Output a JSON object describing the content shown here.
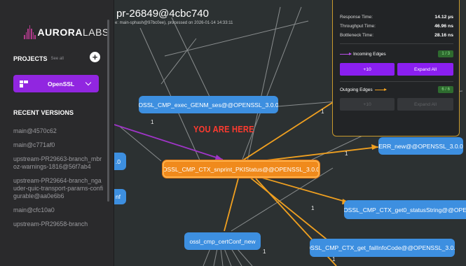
{
  "header": {
    "title": "pr-26849@4cbc740",
    "subtitle": "e: main-sphash@97bc0ee), processed on 2026-01-14 14:33:11"
  },
  "sidebar": {
    "logo_text_bold": "AURORA",
    "logo_text_light": "LABS",
    "projects_label": "PROJECTS",
    "see_all": "See all",
    "add_icon": "+",
    "selected_project": "OpenSSL",
    "recent_title": "RECENT VERSIONS",
    "versions": [
      "main@4570c62",
      "main@c771af0",
      "upstream-PR29663-branch_mbroz-warnings-1816@56f7ab4",
      "upstream-PR29664-branch_ngauder-quic-transport-params-configurable@aa0e6b6",
      "main@cfc10a0",
      "upstream-PR29658-branch"
    ]
  },
  "panel": {
    "stats": [
      {
        "label": "Response Time:",
        "value": "14.12 µs"
      },
      {
        "label": "Throughput Time:",
        "value": "46.96 ns"
      },
      {
        "label": "Bottleneck Time:",
        "value": "28.16 ns"
      }
    ],
    "incoming": {
      "label": "Incoming Edges",
      "count": "1 / 3",
      "btn_left": "+10",
      "btn_right": "Expand All"
    },
    "outgoing": {
      "label": "Outgoing Edges",
      "count": "6 / 6",
      "btn_left": "+10",
      "btn_right": "Expand All"
    }
  },
  "graph": {
    "marker_text": "YOU ARE HERE",
    "nodes": {
      "exec_genm": "OSSL_CMP_exec_GENM_ses@@OPENSSL_3.0.0",
      "focus": "OSSL_CMP_CTX_snprint_PKIStatus@@OPENSSL_3.0.0",
      "err_new": "ERR_new@@OPENSSL_3.0.0",
      "get0_status": "OSSL_CMP_CTX_get0_statusString@@OPE",
      "certconf": "ossl_cmp_certConf_new",
      "failinfo": "OSSL_CMP_CTX_get_failInfoCode@@OPENSSL_3.0.0",
      "left_a": ".0",
      "left_b": "nf"
    },
    "edge_labels": [
      "1",
      "1",
      "1",
      "1",
      "1",
      "1"
    ]
  },
  "colors": {
    "accent_purple": "#8a1ff0",
    "node_blue": "#3d8fe0",
    "node_focus": "#f08a1c",
    "edge_orange": "#f0a020",
    "marker_red": "#ff3a2f"
  }
}
